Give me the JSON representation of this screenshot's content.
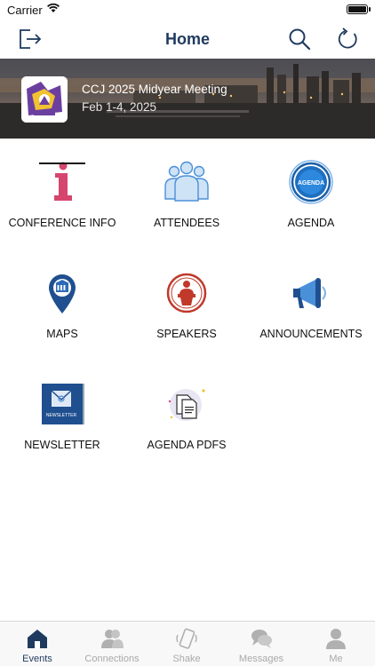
{
  "status_bar": {
    "carrier": "Carrier"
  },
  "nav": {
    "title": "Home"
  },
  "event": {
    "title": "CCJ 2025 Midyear Meeting",
    "dates": "Feb 1-4, 2025"
  },
  "tiles": [
    {
      "label": "CONFERENCE INFO",
      "icon": "info-icon"
    },
    {
      "label": "ATTENDEES",
      "icon": "people-icon"
    },
    {
      "label": "AGENDA",
      "icon": "agenda-icon"
    },
    {
      "label": "MAPS",
      "icon": "map-pin-icon"
    },
    {
      "label": "SPEAKERS",
      "icon": "podium-icon"
    },
    {
      "label": "ANNOUNCEMENTS",
      "icon": "megaphone-icon"
    },
    {
      "label": "NEWSLETTER",
      "icon": "newsletter-icon"
    },
    {
      "label": "AGENDA PDFS",
      "icon": "documents-icon"
    }
  ],
  "agenda_badge_text": "AGENDA",
  "newsletter_badge_text": "NEWSLETTER",
  "tabs": [
    {
      "label": "Events",
      "active": true
    },
    {
      "label": "Connections",
      "active": false
    },
    {
      "label": "Shake",
      "active": false
    },
    {
      "label": "Messages",
      "active": false
    },
    {
      "label": "Me",
      "active": false
    }
  ],
  "colors": {
    "nav_title": "#1f3a5f",
    "accent_blue": "#4a90d9",
    "inactive_tab": "#a9a9a9",
    "info_pink": "#d6456e",
    "speaker_red": "#c0392b"
  }
}
